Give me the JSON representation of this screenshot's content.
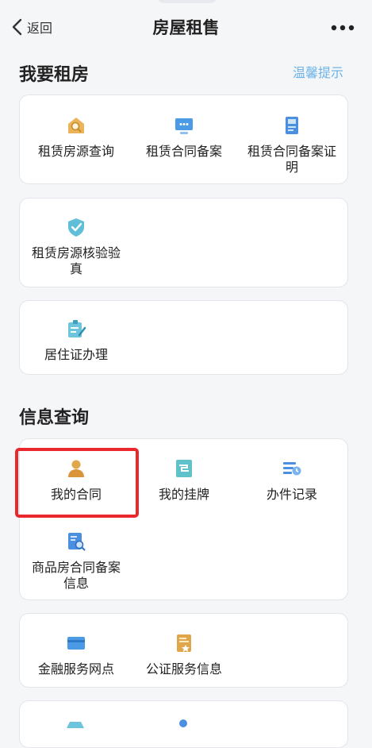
{
  "header": {
    "back_label": "返回",
    "title": "房屋租售",
    "more_icon": "more-dots-icon"
  },
  "rent": {
    "title": "我要租房",
    "tip": "温馨提示",
    "items": [
      {
        "label": "租赁房源查询",
        "icon": "house-search-icon"
      },
      {
        "label": "租赁合同备案",
        "icon": "monitor-icon"
      },
      {
        "label": "租赁合同备案证明",
        "icon": "certificate-icon"
      },
      {
        "label": "租赁房源核验验真",
        "icon": "shield-check-icon"
      },
      {
        "label": "居住证办理",
        "icon": "id-form-icon"
      }
    ]
  },
  "info": {
    "title": "信息查询",
    "items": [
      {
        "label": "我的合同",
        "icon": "user-contract-icon"
      },
      {
        "label": "我的挂牌",
        "icon": "listing-icon"
      },
      {
        "label": "办件记录",
        "icon": "record-clock-icon"
      },
      {
        "label": "商品房合同备案信息",
        "icon": "doc-search-icon"
      },
      {
        "label": "金融服务网点",
        "icon": "card-icon"
      },
      {
        "label": "公证服务信息",
        "icon": "notary-icon"
      }
    ]
  },
  "colors": {
    "accent": "#3d8fe0",
    "tip": "#6db3e7",
    "highlight": "#e8282d",
    "gold": "#e0a64a"
  }
}
